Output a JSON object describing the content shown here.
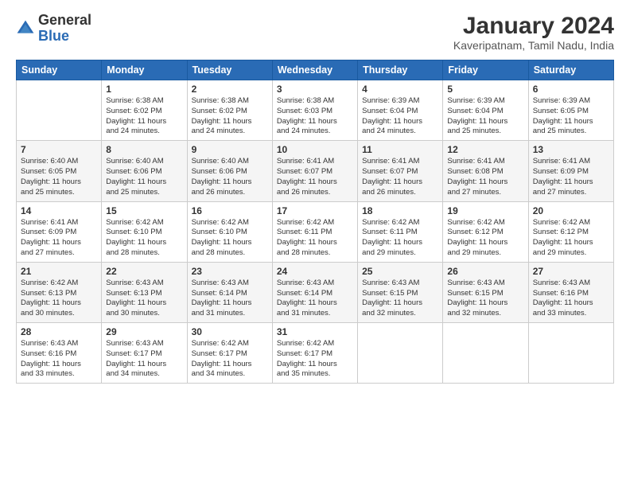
{
  "header": {
    "logo_general": "General",
    "logo_blue": "Blue",
    "title": "January 2024",
    "subtitle": "Kaveripatnam, Tamil Nadu, India"
  },
  "calendar": {
    "days_of_week": [
      "Sunday",
      "Monday",
      "Tuesday",
      "Wednesday",
      "Thursday",
      "Friday",
      "Saturday"
    ],
    "weeks": [
      [
        {
          "day": "",
          "info": ""
        },
        {
          "day": "1",
          "info": "Sunrise: 6:38 AM\nSunset: 6:02 PM\nDaylight: 11 hours\nand 24 minutes."
        },
        {
          "day": "2",
          "info": "Sunrise: 6:38 AM\nSunset: 6:02 PM\nDaylight: 11 hours\nand 24 minutes."
        },
        {
          "day": "3",
          "info": "Sunrise: 6:38 AM\nSunset: 6:03 PM\nDaylight: 11 hours\nand 24 minutes."
        },
        {
          "day": "4",
          "info": "Sunrise: 6:39 AM\nSunset: 6:04 PM\nDaylight: 11 hours\nand 24 minutes."
        },
        {
          "day": "5",
          "info": "Sunrise: 6:39 AM\nSunset: 6:04 PM\nDaylight: 11 hours\nand 25 minutes."
        },
        {
          "day": "6",
          "info": "Sunrise: 6:39 AM\nSunset: 6:05 PM\nDaylight: 11 hours\nand 25 minutes."
        }
      ],
      [
        {
          "day": "7",
          "info": "Sunrise: 6:40 AM\nSunset: 6:05 PM\nDaylight: 11 hours\nand 25 minutes."
        },
        {
          "day": "8",
          "info": "Sunrise: 6:40 AM\nSunset: 6:06 PM\nDaylight: 11 hours\nand 25 minutes."
        },
        {
          "day": "9",
          "info": "Sunrise: 6:40 AM\nSunset: 6:06 PM\nDaylight: 11 hours\nand 26 minutes."
        },
        {
          "day": "10",
          "info": "Sunrise: 6:41 AM\nSunset: 6:07 PM\nDaylight: 11 hours\nand 26 minutes."
        },
        {
          "day": "11",
          "info": "Sunrise: 6:41 AM\nSunset: 6:07 PM\nDaylight: 11 hours\nand 26 minutes."
        },
        {
          "day": "12",
          "info": "Sunrise: 6:41 AM\nSunset: 6:08 PM\nDaylight: 11 hours\nand 27 minutes."
        },
        {
          "day": "13",
          "info": "Sunrise: 6:41 AM\nSunset: 6:09 PM\nDaylight: 11 hours\nand 27 minutes."
        }
      ],
      [
        {
          "day": "14",
          "info": "Sunrise: 6:41 AM\nSunset: 6:09 PM\nDaylight: 11 hours\nand 27 minutes."
        },
        {
          "day": "15",
          "info": "Sunrise: 6:42 AM\nSunset: 6:10 PM\nDaylight: 11 hours\nand 28 minutes."
        },
        {
          "day": "16",
          "info": "Sunrise: 6:42 AM\nSunset: 6:10 PM\nDaylight: 11 hours\nand 28 minutes."
        },
        {
          "day": "17",
          "info": "Sunrise: 6:42 AM\nSunset: 6:11 PM\nDaylight: 11 hours\nand 28 minutes."
        },
        {
          "day": "18",
          "info": "Sunrise: 6:42 AM\nSunset: 6:11 PM\nDaylight: 11 hours\nand 29 minutes."
        },
        {
          "day": "19",
          "info": "Sunrise: 6:42 AM\nSunset: 6:12 PM\nDaylight: 11 hours\nand 29 minutes."
        },
        {
          "day": "20",
          "info": "Sunrise: 6:42 AM\nSunset: 6:12 PM\nDaylight: 11 hours\nand 29 minutes."
        }
      ],
      [
        {
          "day": "21",
          "info": "Sunrise: 6:42 AM\nSunset: 6:13 PM\nDaylight: 11 hours\nand 30 minutes."
        },
        {
          "day": "22",
          "info": "Sunrise: 6:43 AM\nSunset: 6:13 PM\nDaylight: 11 hours\nand 30 minutes."
        },
        {
          "day": "23",
          "info": "Sunrise: 6:43 AM\nSunset: 6:14 PM\nDaylight: 11 hours\nand 31 minutes."
        },
        {
          "day": "24",
          "info": "Sunrise: 6:43 AM\nSunset: 6:14 PM\nDaylight: 11 hours\nand 31 minutes."
        },
        {
          "day": "25",
          "info": "Sunrise: 6:43 AM\nSunset: 6:15 PM\nDaylight: 11 hours\nand 32 minutes."
        },
        {
          "day": "26",
          "info": "Sunrise: 6:43 AM\nSunset: 6:15 PM\nDaylight: 11 hours\nand 32 minutes."
        },
        {
          "day": "27",
          "info": "Sunrise: 6:43 AM\nSunset: 6:16 PM\nDaylight: 11 hours\nand 33 minutes."
        }
      ],
      [
        {
          "day": "28",
          "info": "Sunrise: 6:43 AM\nSunset: 6:16 PM\nDaylight: 11 hours\nand 33 minutes."
        },
        {
          "day": "29",
          "info": "Sunrise: 6:43 AM\nSunset: 6:17 PM\nDaylight: 11 hours\nand 34 minutes."
        },
        {
          "day": "30",
          "info": "Sunrise: 6:42 AM\nSunset: 6:17 PM\nDaylight: 11 hours\nand 34 minutes."
        },
        {
          "day": "31",
          "info": "Sunrise: 6:42 AM\nSunset: 6:17 PM\nDaylight: 11 hours\nand 35 minutes."
        },
        {
          "day": "",
          "info": ""
        },
        {
          "day": "",
          "info": ""
        },
        {
          "day": "",
          "info": ""
        }
      ]
    ]
  }
}
